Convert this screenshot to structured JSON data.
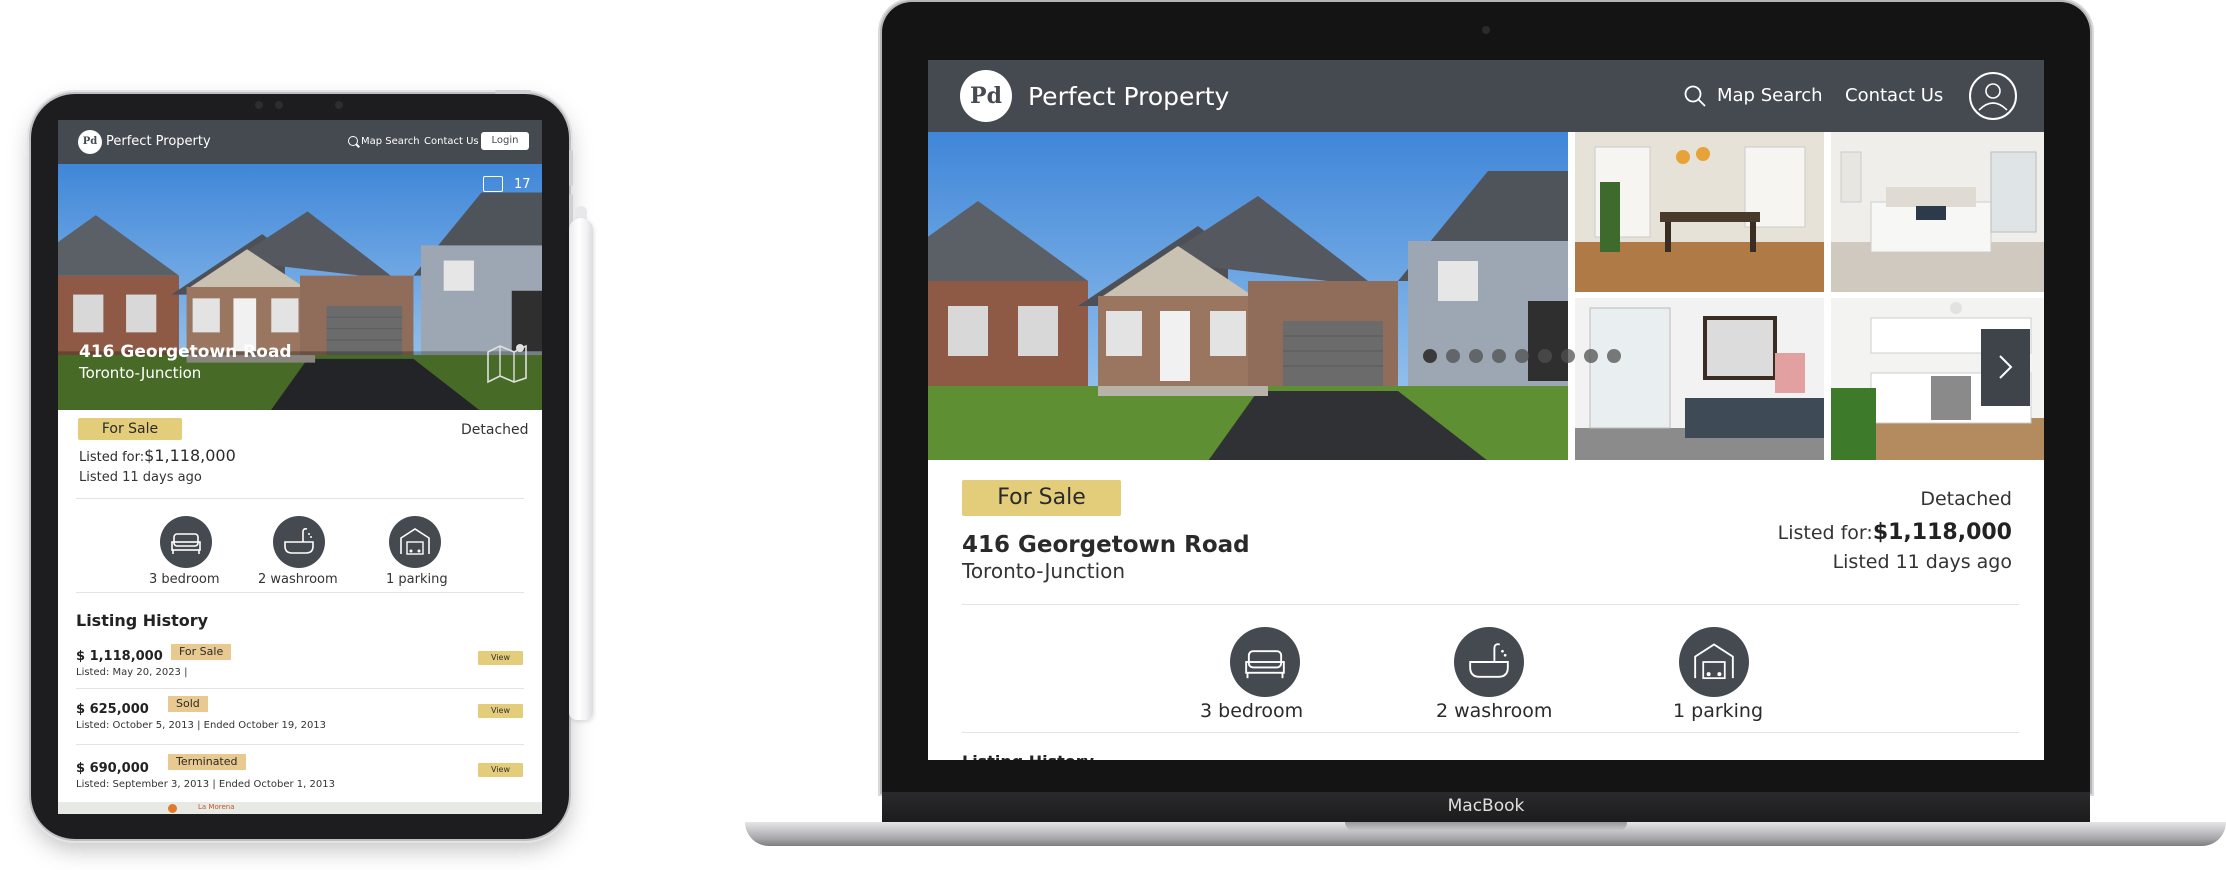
{
  "brand": {
    "name": "Perfect Property",
    "logo_text": "Pd"
  },
  "nav": {
    "map_search": "Map Search",
    "contact": "Contact Us",
    "login": "Login"
  },
  "listing": {
    "status": "For Sale",
    "address_line1": "416 Georgetown Road",
    "address_line2": "Toronto-Junction",
    "type": "Detached",
    "listed_for_label": "Listed for:",
    "price": "$1,118,000",
    "listed_ago": "Listed 11 days ago",
    "photo_count": "17",
    "features": {
      "bedroom": "3 bedroom",
      "washroom": "2 washroom",
      "parking": "1 parking"
    }
  },
  "history": {
    "title": "Listing History",
    "view_label": "View",
    "rows": [
      {
        "price": "$ 1,118,000",
        "status": "For Sale",
        "status_color": "#e8c98f",
        "dates": "Listed: May 20, 2023 |"
      },
      {
        "price": "$ 625,000",
        "status": "Sold",
        "status_color": "#e8c98f",
        "dates": "Listed: October 5, 2013  | Ended October 19, 2013"
      },
      {
        "price": "$ 690,000",
        "status": "Terminated",
        "status_color": "#e8c98f",
        "dates": "Listed: September 3, 2013  | Ended October 1, 2013"
      }
    ]
  },
  "map": {
    "label1": "La Morena"
  },
  "device": {
    "laptop_label": "MacBook"
  },
  "colors": {
    "header": "#454a51",
    "accent": "#e3cc7a"
  },
  "gallery": {
    "active_dot": 1,
    "dot_count": 9
  }
}
